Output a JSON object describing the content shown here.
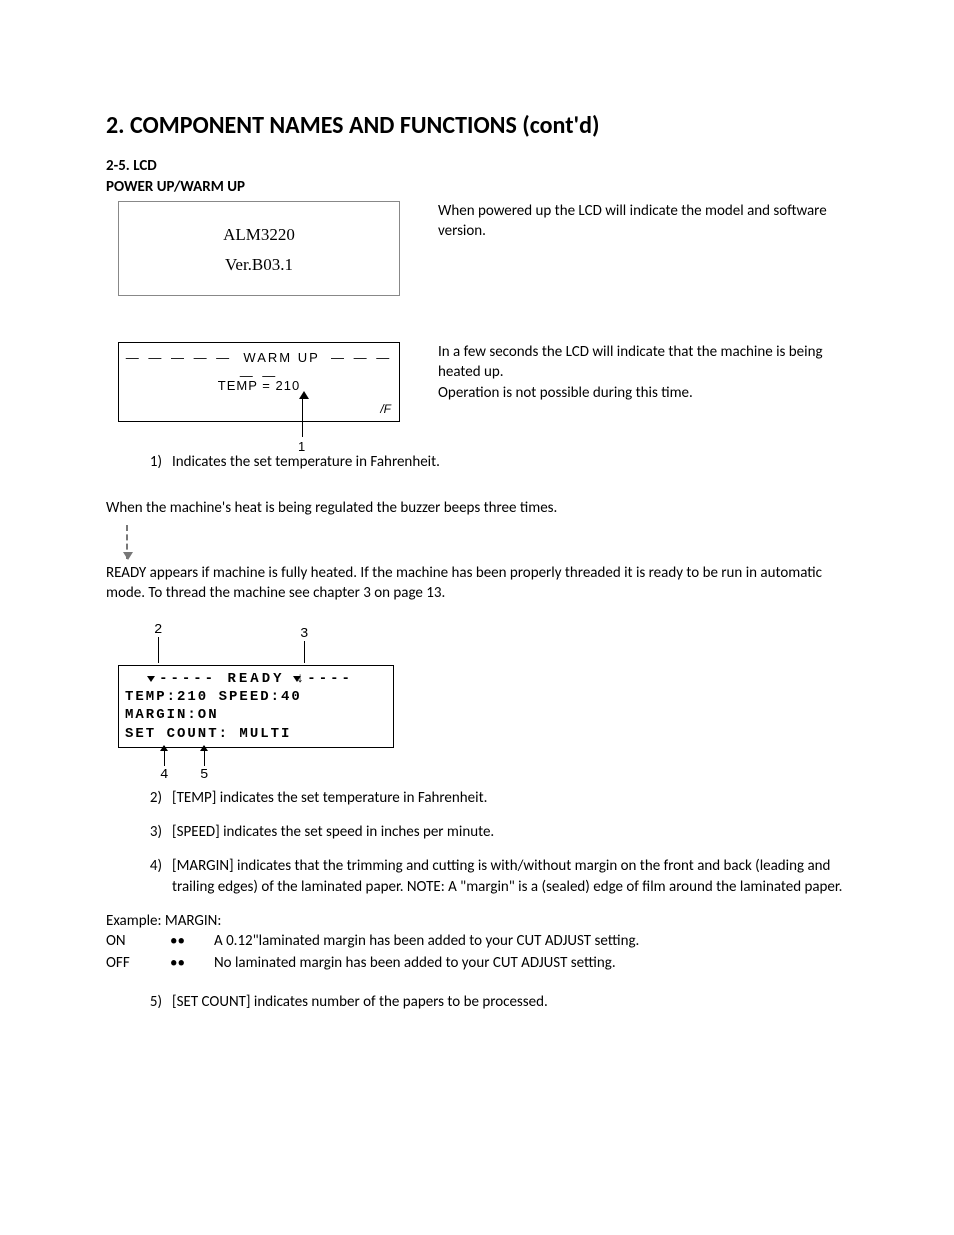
{
  "heading": "2. COMPONENT NAMES AND FUNCTIONS (cont'd)",
  "sub1": "2-5. LCD",
  "sub2": "POWER UP/WARM UP",
  "lcd1_line1": "ALM3220",
  "lcd1_line2": "Ver.B03.1",
  "desc1": "When powered up the LCD will indicate the model and software version.",
  "warmup": {
    "title": "WARM UP",
    "temp_label": "TEMP  =  210",
    "unit": "/F",
    "callout": "1"
  },
  "desc2a": "In a few seconds the LCD will indicate that the machine is being heated up.",
  "desc2b": "Operation is not possible during this time.",
  "item1_num": "1)",
  "item1_text": "Indicates the set temperature in Fahrenheit.",
  "para2": "When the machine's heat is being regulated the buzzer beeps three times.",
  "para3": "READY  appears if machine is fully heated. If the machine has been properly threaded it is ready to be run in automatic mode. To thread the machine see chapter 3 on page 13.",
  "ready": {
    "c2": "2",
    "c3": "3",
    "c4": "4",
    "c5": "5",
    "line1": "----- READY ↓----",
    "line2": "TEMP:210   SPEED:40",
    "line3": "MARGIN:ON",
    "line4": "SET COUNT: MULTI"
  },
  "item2_num": "2)",
  "item2_text": "[TEMP] indicates the set temperature in Fahrenheit.",
  "item3_num": "3)",
  "item3_text": "[SPEED] indicates the set speed in inches per minute.",
  "item4_num": "4)",
  "item4_text": "[MARGIN] indicates that the trimming and cutting is with/without margin on the front and back (leading and trailing edges) of the laminated paper. NOTE: A \"margin\" is a (sealed) edge of film around the laminated paper.",
  "example_label": "Example: MARGIN:",
  "ex_on": "ON",
  "ex_off": "OFF",
  "bullets": "••",
  "ex_on_text": "A 0.12\"laminated margin has been added to your CUT ADJUST setting.",
  "ex_off_text": "No laminated margin has been added to your CUT ADJUST setting.",
  "item5_num": "5)",
  "item5_text": "[SET COUNT] indicates number of the papers to be processed."
}
